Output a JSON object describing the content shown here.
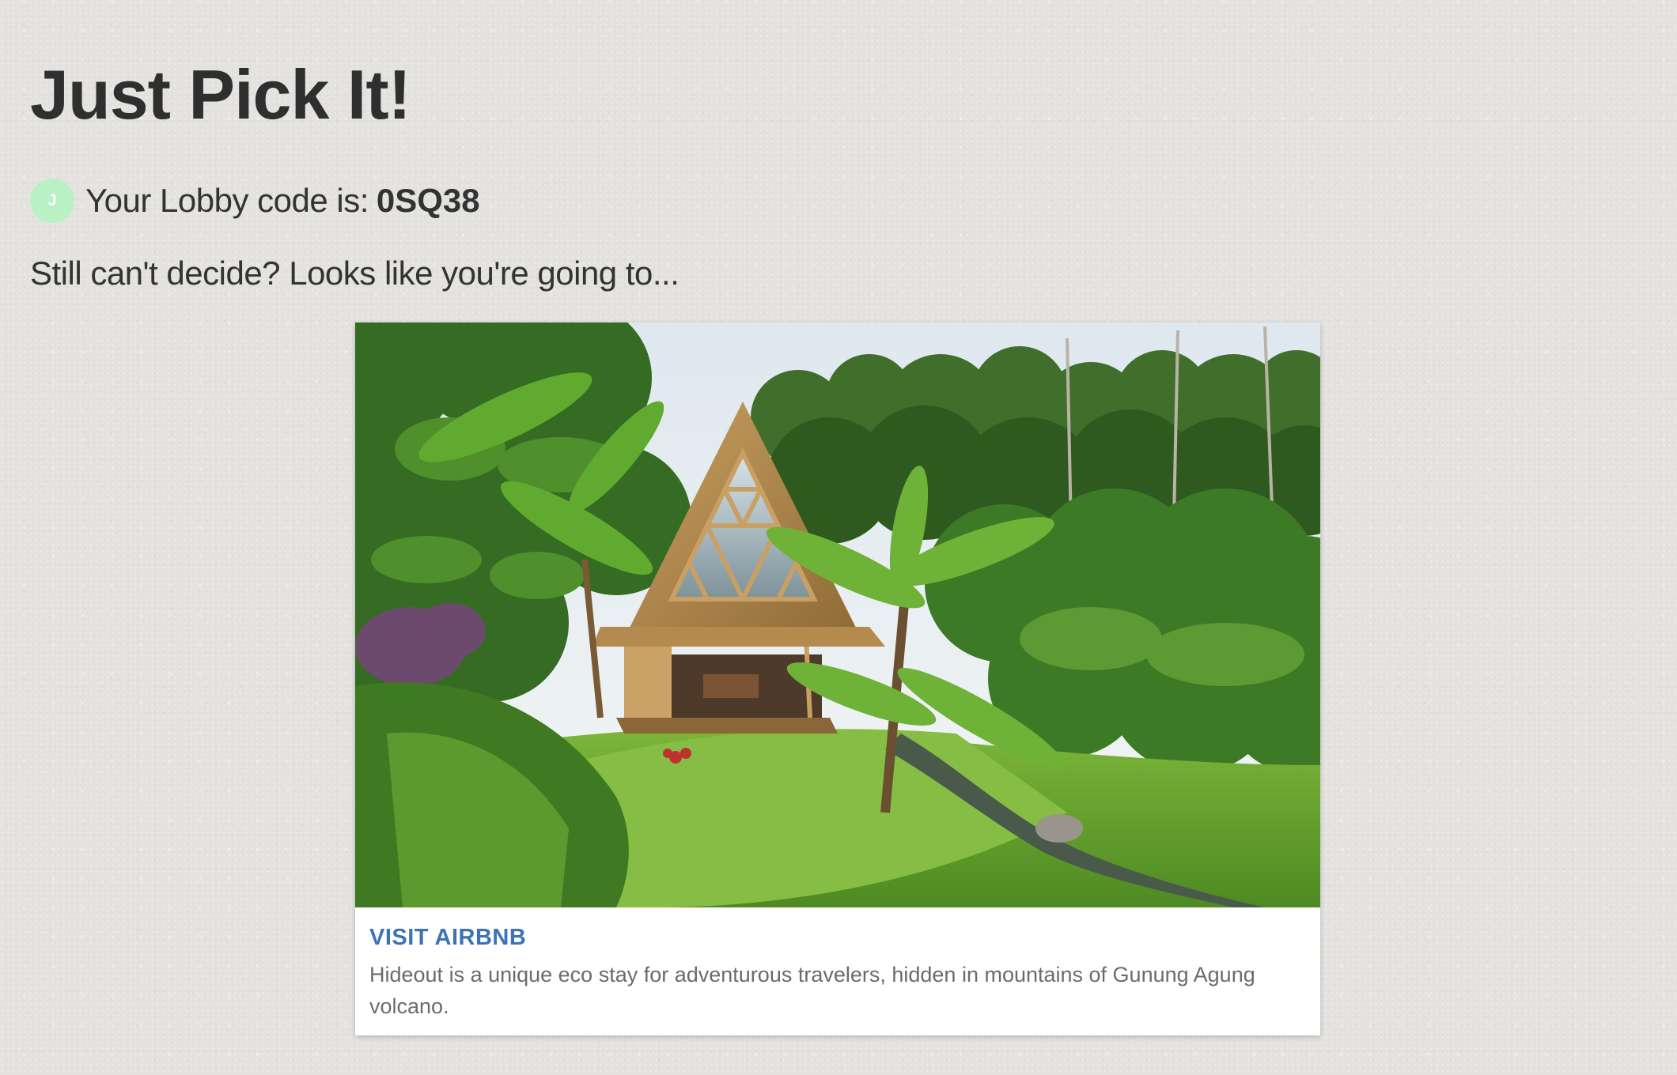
{
  "header": {
    "title": "Just Pick It!"
  },
  "lobby": {
    "avatar_initial": "J",
    "label": "Your Lobby code is:",
    "code": "0SQ38"
  },
  "tagline": "Still can't decide? Looks like you're going to...",
  "result_card": {
    "image_subject": "bamboo A-frame hut in tropical jungle",
    "link_label": "VISIT AIRBNB",
    "description": "Hideout is a unique eco stay for adventurous travelers, hidden in mountains of Gunung Agung volcano."
  },
  "colors": {
    "link": "#3c73b7",
    "avatar": "#b9f0c4",
    "background": "#e4e2df"
  }
}
